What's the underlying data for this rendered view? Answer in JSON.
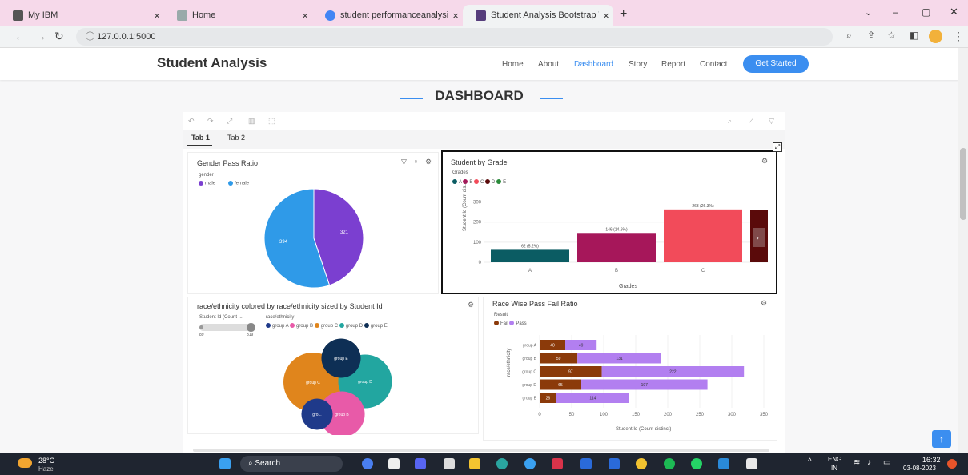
{
  "browser": {
    "tabs": [
      {
        "title": "My IBM",
        "active": false
      },
      {
        "title": "Home",
        "active": false
      },
      {
        "title": "student performanceanalysis ima",
        "active": false
      },
      {
        "title": "Student Analysis Bootstrap Temp",
        "active": true
      }
    ],
    "url": "127.0.0.1:5000"
  },
  "site": {
    "brand": "Student Analysis",
    "nav": [
      "Home",
      "About",
      "Dashboard",
      "Story",
      "Report",
      "Contact"
    ],
    "active_nav": "Dashboard",
    "cta": "Get Started"
  },
  "dashboard": {
    "heading": "DASHBOARD",
    "tabs": [
      "Tab 1",
      "Tab 2"
    ],
    "active_tab": "Tab 1"
  },
  "panels": {
    "gender": {
      "title": "Gender Pass Ratio",
      "legend_title": "gender",
      "legend": [
        {
          "name": "male",
          "color": "#7b3fd0"
        },
        {
          "name": "female",
          "color": "#2f9ae8"
        }
      ]
    },
    "grade": {
      "title": "Student by Grade",
      "legend_title": "Grades",
      "legend": [
        {
          "name": "A",
          "color": "#0b5c63"
        },
        {
          "name": "B",
          "color": "#a6175a"
        },
        {
          "name": "C",
          "color": "#f24b5a"
        },
        {
          "name": "D",
          "color": "#5a0a0a"
        },
        {
          "name": "E",
          "color": "#2a8a3a"
        }
      ],
      "xlabel": "Grades",
      "ylabel": "Student Id (Count dis..."
    },
    "race_bubble": {
      "title": "race/ethnicity colored by race/ethnicity sized by Student Id",
      "slider_label": "Student Id (Count ...",
      "slider_min": "89",
      "slider_max": "319",
      "legend_title": "race/ethnicity",
      "legend": [
        {
          "name": "group A",
          "color": "#1f3a8a"
        },
        {
          "name": "group B",
          "color": "#e85aa8"
        },
        {
          "name": "group C",
          "color": "#e0851c"
        },
        {
          "name": "group D",
          "color": "#22a6a0"
        },
        {
          "name": "group E",
          "color": "#0e2f55"
        }
      ],
      "bubbles": [
        {
          "label": "group C",
          "color": "#e0851c"
        },
        {
          "label": "group D",
          "color": "#22a6a0"
        },
        {
          "label": "group E",
          "color": "#0e2f55"
        },
        {
          "label": "group B",
          "color": "#e85aa8"
        },
        {
          "label": "gro...",
          "color": "#1f3a8a"
        }
      ]
    },
    "race_pass": {
      "title": "Race Wise Pass Fail Ratio",
      "legend_title": "Result",
      "legend": [
        {
          "name": "Fail",
          "color": "#8b3a0a"
        },
        {
          "name": "Pass",
          "color": "#b27ff0"
        }
      ],
      "xlabel": "Student Id (Count distinct)",
      "ylabel": "race/ethnicity"
    }
  },
  "chart_data": [
    {
      "type": "pie",
      "title": "Gender Pass Ratio",
      "categories": [
        "male",
        "female"
      ],
      "values": [
        321,
        394
      ],
      "colors": [
        "#7b3fd0",
        "#2f9ae8"
      ]
    },
    {
      "type": "bar",
      "title": "Student by Grade",
      "categories": [
        "A",
        "B",
        "C",
        "D"
      ],
      "values": [
        62,
        146,
        263,
        259
      ],
      "data_labels": [
        "62 (5.2%)",
        "146 (14.6%)",
        "263 (26.3%)",
        ""
      ],
      "colors": [
        "#0b5c63",
        "#a6175a",
        "#f24b5a",
        "#5a0a0a"
      ],
      "xlabel": "Grades",
      "ylabel": "Student Id (Count dis...",
      "yticks": [
        0,
        100,
        200,
        300
      ],
      "ylim": [
        0,
        330
      ]
    },
    {
      "type": "scatter",
      "title": "race/ethnicity colored by race/ethnicity sized by Student Id",
      "categories": [
        "group C",
        "group D",
        "group E",
        "group B",
        "group A"
      ],
      "values": [
        319,
        262,
        140,
        190,
        89
      ]
    },
    {
      "type": "bar",
      "orientation": "horizontal",
      "title": "Race Wise Pass Fail Ratio",
      "categories": [
        "group A",
        "group B",
        "group C",
        "group D",
        "group E"
      ],
      "series": [
        {
          "name": "Fail",
          "values": [
            40,
            59,
            97,
            65,
            26
          ]
        },
        {
          "name": "Pass",
          "values": [
            49,
            131,
            222,
            197,
            114
          ]
        }
      ],
      "xlabel": "Student Id (Count distinct)",
      "ylabel": "race/ethnicity",
      "xticks": [
        0,
        50,
        100,
        150,
        200,
        250,
        300,
        350
      ],
      "xlim": [
        0,
        350
      ]
    }
  ],
  "taskbar": {
    "weather_temp": "28°C",
    "weather_desc": "Haze",
    "search_label": "Search",
    "lang_top": "ENG",
    "lang_bottom": "IN",
    "time": "16:32",
    "date": "03-08-2023"
  }
}
